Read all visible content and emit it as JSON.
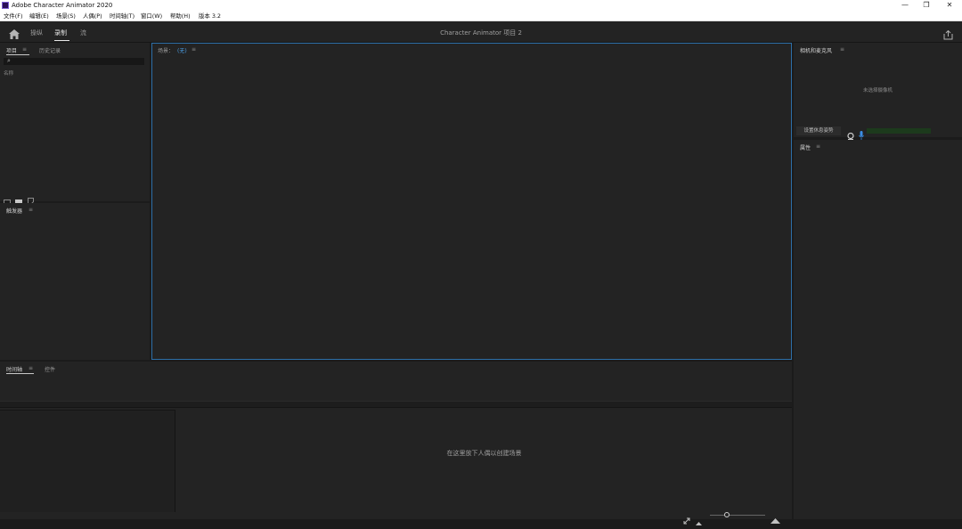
{
  "window": {
    "title": "Adobe Character Animator 2020",
    "controls": {
      "minimize": "—",
      "restore": "❐",
      "close": "✕"
    }
  },
  "menubar": {
    "items": [
      "文件(F)",
      "编辑(E)",
      "场景(S)",
      "人偶(P)",
      "时间轴(T)",
      "窗口(W)",
      "帮助(H)",
      "版本 3.2"
    ]
  },
  "workspace": {
    "tabs": [
      "操纵",
      "录制",
      "流"
    ],
    "active_tab": "录制",
    "project_title": "Character Animator 项目 2"
  },
  "project_panel": {
    "tabs": [
      "项目",
      "历史记录"
    ],
    "search_placeholder": "",
    "column_name": "名称"
  },
  "trigger_panel": {
    "title": "触发器"
  },
  "scene_panel": {
    "title": "场景：",
    "scene_value": "(无)"
  },
  "camera_panel": {
    "title": "相机和麦克风",
    "status": "未选择摄像机",
    "rest_pose_button": "设置休息姿势"
  },
  "properties_panel": {
    "title": "属性"
  },
  "timeline_panel": {
    "tabs": [
      "时间轴",
      "控件"
    ],
    "drop_hint": "在这里放下人偶以创建场景",
    "zoom_level": 0.3
  },
  "icons": {
    "home": "home-icon",
    "share": "share-icon",
    "search": "search-icon",
    "webcam": "webcam-icon",
    "mic": "microphone-icon"
  },
  "colors": {
    "accent": "#2d6fa8",
    "scene_value": "#4a9be0",
    "mic": "#3b8ee6",
    "level_meter": "#1c3a1c"
  }
}
